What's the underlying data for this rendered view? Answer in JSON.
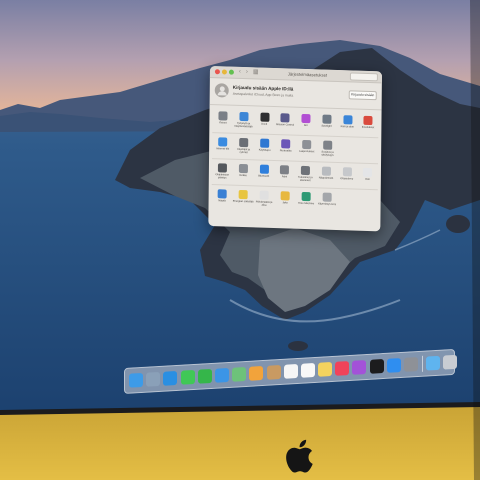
{
  "window": {
    "title": "Järjestelmäasetukset",
    "account": {
      "title": "Kirjaudu sisään Apple ID:llä",
      "subtitle": "Asetapalvelut iCloud, App Store ja muita",
      "signin_button": "Kirjaudu sisään"
    },
    "rows": [
      [
        {
          "icon": "general-icon",
          "label": "Yleiset",
          "color": "#7a7f86"
        },
        {
          "icon": "desktop-icon",
          "label": "Työpöytä ja Näytönsäästäjä",
          "color": "#3d86d6"
        },
        {
          "icon": "dock-icon",
          "label": "Dock",
          "color": "#2f2f31"
        },
        {
          "icon": "mission-control-icon",
          "label": "Mission Control",
          "color": "#5a5a8c"
        },
        {
          "icon": "siri-icon",
          "label": "Siri",
          "color": "#b24fd3"
        },
        {
          "icon": "spotlight-icon",
          "label": "Spotlight",
          "color": "#6f7a86"
        },
        {
          "icon": "language-icon",
          "label": "Kieli ja alue",
          "color": "#3a85d8"
        },
        {
          "icon": "notifications-icon",
          "label": "Ilmoitukset",
          "color": "#d94a3d"
        }
      ],
      [
        {
          "icon": "internet-accounts-icon",
          "label": "Internet-tilit",
          "color": "#3a8be0"
        },
        {
          "icon": "users-icon",
          "label": "Käyttäjät ja ryhmät",
          "color": "#6b6f76"
        },
        {
          "icon": "accessibility-icon",
          "label": "Käyttöapu",
          "color": "#2f78d2"
        },
        {
          "icon": "screen-time-icon",
          "label": "Ruutuaika",
          "color": "#6b56b8"
        },
        {
          "icon": "extensions-icon",
          "label": "Laajennukset",
          "color": "#8d9096"
        },
        {
          "icon": "security-icon",
          "label": "Suojaus ja yksityisyys",
          "color": "#7e8288"
        }
      ],
      [
        {
          "icon": "software-update-icon",
          "label": "Ohjelmiston päivitys",
          "color": "#55585d"
        },
        {
          "icon": "network-icon",
          "label": "Verkko",
          "color": "#8a8e94"
        },
        {
          "icon": "bluetooth-icon",
          "label": "Bluetooth",
          "color": "#2f7fdc"
        },
        {
          "icon": "sound-icon",
          "label": "Ääni",
          "color": "#7d8086"
        },
        {
          "icon": "printers-icon",
          "label": "Tulostimet ja skannerit",
          "color": "#6e7278"
        },
        {
          "icon": "keyboard-icon",
          "label": "Näppäimistö",
          "color": "#b8bbbf"
        },
        {
          "icon": "trackpad-icon",
          "label": "Ohjauslevy",
          "color": "#c6c8cb"
        },
        {
          "icon": "mouse-icon",
          "label": "Hiiri",
          "color": "#e4e5e7"
        }
      ],
      [
        {
          "icon": "displays-icon",
          "label": "Näytöt",
          "color": "#3a80d4"
        },
        {
          "icon": "energy-saver-icon",
          "label": "Energian säästäjä",
          "color": "#e8c540"
        },
        {
          "icon": "date-time-icon",
          "label": "Päivämäärä ja aika",
          "color": "#e0e0e0"
        },
        {
          "icon": "sharing-icon",
          "label": "Jako",
          "color": "#e7b840"
        },
        {
          "icon": "time-machine-icon",
          "label": "Time Machine",
          "color": "#2e9a74"
        },
        {
          "icon": "startup-disk-icon",
          "label": "Käynnistys-levy",
          "color": "#a3a6aa"
        }
      ]
    ]
  },
  "dock": {
    "items": [
      {
        "icon": "finder-icon",
        "color": "#3d9be8"
      },
      {
        "icon": "launchpad-icon",
        "color": "#8aa0b8"
      },
      {
        "icon": "safari-icon",
        "color": "#2a8fe2"
      },
      {
        "icon": "messages-icon",
        "color": "#40c856"
      },
      {
        "icon": "facetime-icon",
        "color": "#35b64a"
      },
      {
        "icon": "mail-icon",
        "color": "#3b95e6"
      },
      {
        "icon": "maps-icon",
        "color": "#6dc27a"
      },
      {
        "icon": "photos-icon",
        "color": "#f2a33b"
      },
      {
        "icon": "contacts-icon",
        "color": "#c99a62"
      },
      {
        "icon": "calendar-icon",
        "color": "#f6f6f6"
      },
      {
        "icon": "reminders-icon",
        "color": "#f8f8f8"
      },
      {
        "icon": "notes-icon",
        "color": "#f4d35e"
      },
      {
        "icon": "music-icon",
        "color": "#f0435a"
      },
      {
        "icon": "podcasts-icon",
        "color": "#a352d8"
      },
      {
        "icon": "tv-icon",
        "color": "#1c1c1e"
      },
      {
        "icon": "app-store-icon",
        "color": "#2f8ef0"
      },
      {
        "icon": "system-preferences-icon",
        "color": "#8e9197"
      },
      {
        "icon": "downloads-folder-icon",
        "color": "#5fb4ef"
      },
      {
        "icon": "trash-icon",
        "color": "#c8ccd2"
      }
    ]
  }
}
